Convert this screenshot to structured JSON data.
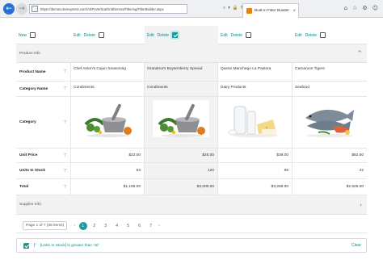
{
  "browser": {
    "url": "https://demos.devexpress.com/ASPxVerticalGridDemos/Filtering/FilterBuilder.aspx",
    "tab_title": "Built-in Filter Builder - DevE...",
    "tab_close": "×",
    "back_icon": "arrow-left-icon",
    "forward_icon": "arrow-right-icon",
    "address_tools": [
      "⌕",
      "▾",
      "🔒",
      "↻"
    ],
    "window_tools": [
      "⌂",
      "☆",
      "⚙",
      "☺"
    ]
  },
  "grid": {
    "new_label": "New",
    "edit_label": "Edit",
    "delete_label": "Delete",
    "product_info_band": "Product Info",
    "supplier_info_band": "Supplier Info",
    "band_collapse_icon": "^",
    "band_expand_icon": "›",
    "filter_icon": "⊤",
    "rows": {
      "product_name": "Product Name",
      "category_name": "Category Name",
      "category": "Category",
      "unit_price": "Unit Price",
      "units_in_stock": "Units In Stock",
      "total": "Total"
    },
    "records": [
      {
        "product_name": "Chef Anton's Cajun Seasoning",
        "category_name": "Condiments",
        "picture": "condiments-picture",
        "unit_price": "$22.00",
        "units_in_stock": "53",
        "total": "$1,166.00",
        "selected": false
      },
      {
        "product_name": "Grandma's Boysenberry Spread",
        "category_name": "Condiments",
        "picture": "condiments-picture",
        "unit_price": "$25.00",
        "units_in_stock": "120",
        "total": "$3,000.00",
        "selected": true
      },
      {
        "product_name": "Queso Manchego La Pastora",
        "category_name": "Dairy Products",
        "picture": "dairy-products-picture",
        "unit_price": "$38.00",
        "units_in_stock": "86",
        "total": "$3,268.00",
        "selected": false
      },
      {
        "product_name": "Carnarvon Tigers",
        "category_name": "Seafood",
        "picture": "seafood-picture",
        "unit_price": "$62.50",
        "units_in_stock": "42",
        "total": "$2,625.00",
        "selected": false
      }
    ]
  },
  "pager": {
    "summary": "Page 1 of 7 (25 items)",
    "prev_icon": "‹",
    "next_icon": "›",
    "pages": [
      "1",
      "2",
      "3",
      "4",
      "5",
      "6",
      "7"
    ],
    "current_page": "1"
  },
  "filter": {
    "enabled": true,
    "icon": "ƒ",
    "expression": "[Units In Stock] is greater than '40'",
    "clear_label": "Clear"
  },
  "colors": {
    "accent": "#1a9aa0",
    "link": "#0e8a8a",
    "band_bg": "#f2f2f2"
  }
}
